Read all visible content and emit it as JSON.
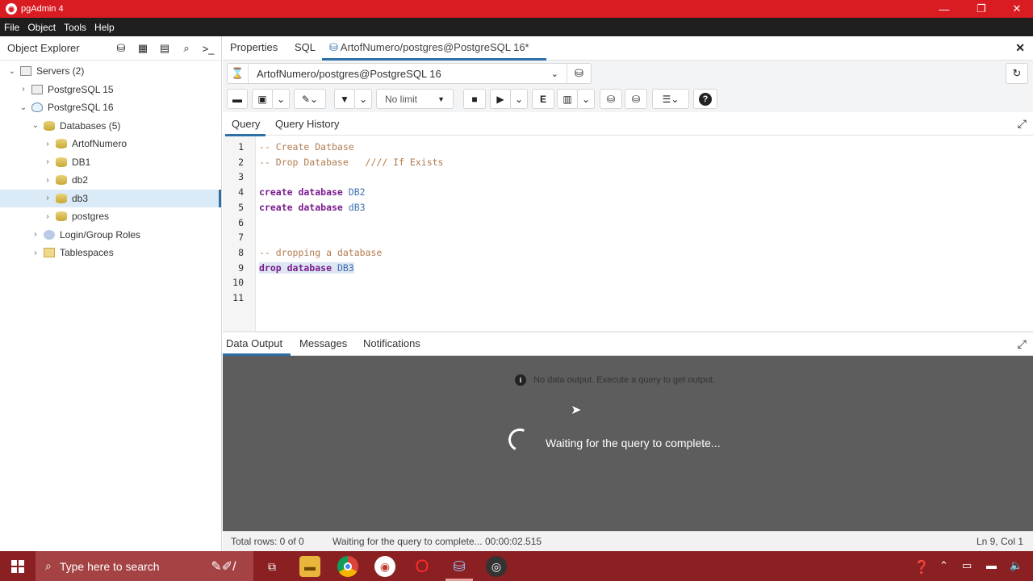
{
  "window": {
    "title": "pgAdmin 4",
    "min": "—",
    "restore": "❐",
    "close": "✕"
  },
  "menu": [
    "File",
    "Object",
    "Tools",
    "Help"
  ],
  "explorer": {
    "title": "Object Explorer",
    "tree": [
      {
        "label": "Servers (2)",
        "level": 0,
        "expanded": true,
        "icon": "servers-icon"
      },
      {
        "label": "PostgreSQL 15",
        "level": 1,
        "expanded": false,
        "icon": "server-icon"
      },
      {
        "label": "PostgreSQL 16",
        "level": 1,
        "expanded": true,
        "icon": "postgres-elephant-icon"
      },
      {
        "label": "Databases (5)",
        "level": 2,
        "expanded": true,
        "icon": "databases-icon"
      },
      {
        "label": "ArtofNumero",
        "level": 3,
        "expanded": false,
        "icon": "database-icon"
      },
      {
        "label": "DB1",
        "level": 3,
        "expanded": false,
        "icon": "database-icon"
      },
      {
        "label": "db2",
        "level": 3,
        "expanded": false,
        "icon": "database-icon"
      },
      {
        "label": "db3",
        "level": 3,
        "expanded": false,
        "icon": "database-icon",
        "selected": true
      },
      {
        "label": "postgres",
        "level": 3,
        "expanded": false,
        "icon": "database-icon"
      },
      {
        "label": "Login/Group Roles",
        "level": 2,
        "expanded": false,
        "icon": "roles-icon"
      },
      {
        "label": "Tablespaces",
        "level": 2,
        "expanded": false,
        "icon": "tablespaces-icon"
      }
    ]
  },
  "tabs": {
    "properties": "Properties",
    "sql": "SQL",
    "query_tab": "ArtofNumero/postgres@PostgreSQL 16*"
  },
  "connection": {
    "value": "ArtofNumero/postgres@PostgreSQL 16"
  },
  "toolbar": {
    "limit": "No limit"
  },
  "query_tabs": {
    "query": "Query",
    "history": "Query History"
  },
  "editor": {
    "lines": [
      {
        "n": "1",
        "text": "-- Create Datbase",
        "type": "comment"
      },
      {
        "n": "2",
        "text": "-- Drop Database   //// If Exists",
        "type": "comment"
      },
      {
        "n": "3",
        "text": "",
        "type": "blank"
      },
      {
        "n": "4",
        "kw": "create database",
        "id": "DB2",
        "type": "code"
      },
      {
        "n": "5",
        "kw": "create database",
        "id": "dB3",
        "type": "code"
      },
      {
        "n": "6",
        "text": "",
        "type": "blank"
      },
      {
        "n": "7",
        "text": "",
        "type": "blank"
      },
      {
        "n": "8",
        "text": "-- dropping a database",
        "type": "comment"
      },
      {
        "n": "9",
        "kw": "drop database",
        "id": "DB3",
        "type": "code",
        "highlight": true
      },
      {
        "n": "10",
        "text": "",
        "type": "blank"
      },
      {
        "n": "11",
        "text": "",
        "type": "blank"
      }
    ]
  },
  "results": {
    "tabs": [
      "Data Output",
      "Messages",
      "Notifications"
    ],
    "no_data": "No data output. Execute a query to get output.",
    "waiting": "Waiting for the query to complete..."
  },
  "status": {
    "rows": "Total rows: 0 of 0",
    "message": "Waiting for the query to complete... 00:00:02.515",
    "position": "Ln 9, Col 1"
  },
  "taskbar": {
    "search_placeholder": "Type here to search"
  },
  "colors": {
    "titlebar": "#d91c22",
    "taskbar": "#8a2022",
    "accent": "#2f6fa8"
  }
}
